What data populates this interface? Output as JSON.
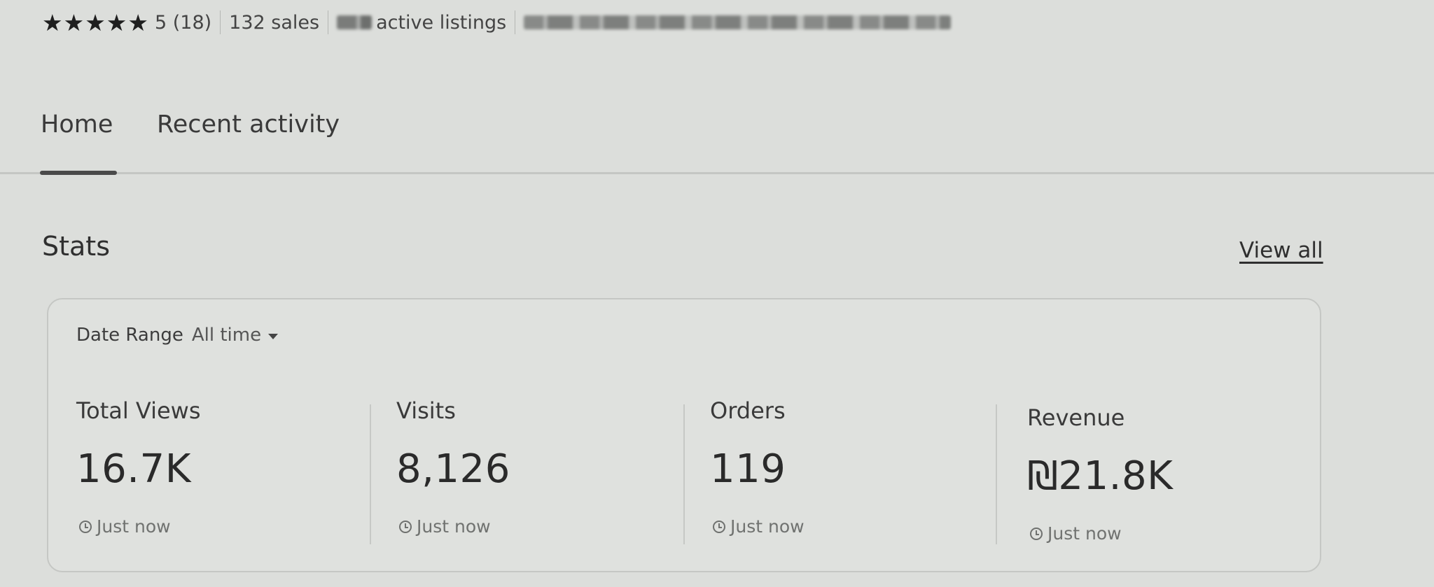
{
  "shop_meta": {
    "rating_stars": 5,
    "rating_text": "5 (18)",
    "sales_text": "132 sales",
    "listings_text": "active listings"
  },
  "tabs": [
    {
      "label": "Home",
      "active": true
    },
    {
      "label": "Recent activity",
      "active": false
    }
  ],
  "stats": {
    "title": "Stats",
    "view_all_label": "View all",
    "date_range_label": "Date Range",
    "date_range_value": "All time",
    "metrics": [
      {
        "label": "Total Views",
        "value": "16.7K",
        "updated": "Just now"
      },
      {
        "label": "Visits",
        "value": "8,126",
        "updated": "Just now"
      },
      {
        "label": "Orders",
        "value": "119",
        "updated": "Just now"
      },
      {
        "label": "Revenue",
        "value": "₪21.8K",
        "updated": "Just now"
      }
    ]
  },
  "icons": [
    "star-icon",
    "caret-down-icon",
    "clock-icon"
  ]
}
